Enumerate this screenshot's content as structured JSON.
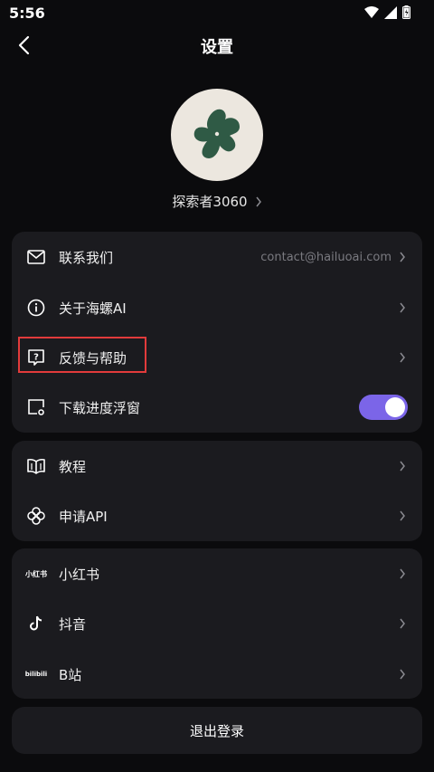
{
  "status_bar": {
    "time": "5:56"
  },
  "header": {
    "title": "设置"
  },
  "profile": {
    "username": "探索者3060"
  },
  "group1": {
    "items": [
      {
        "label": "联系我们",
        "value": "contact@hailuoai.com",
        "icon": "mail-icon"
      },
      {
        "label": "关于海螺AI",
        "icon": "info-icon"
      },
      {
        "label": "反馈与帮助",
        "icon": "help-icon"
      },
      {
        "label": "下载进度浮窗",
        "icon": "float-window-icon",
        "toggle_on": true
      }
    ]
  },
  "group2": {
    "items": [
      {
        "label": "教程",
        "icon": "book-icon"
      },
      {
        "label": "申请API",
        "icon": "api-icon"
      }
    ]
  },
  "group3": {
    "items": [
      {
        "label": "小红书",
        "icon": "xiaohongshu-icon",
        "icon_text": "小红书"
      },
      {
        "label": "抖音",
        "icon": "tiktok-icon"
      },
      {
        "label": "B站",
        "icon": "bilibili-icon",
        "icon_text": "bilibili"
      }
    ]
  },
  "logout": {
    "label": "退出登录"
  },
  "colors": {
    "accent": "#7b65e8",
    "card": "#1b1b1f",
    "background": "#0b0b0d",
    "highlight": "#e23b3b",
    "avatar_bg": "#ece7df",
    "avatar_shape": "#2f5a45"
  }
}
